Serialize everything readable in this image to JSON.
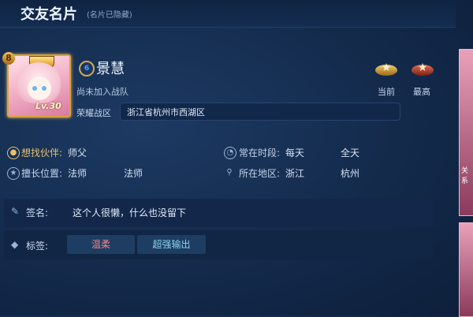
{
  "header": {
    "title": "交友名片",
    "subtitle": "(名片已隐藏)"
  },
  "profile": {
    "level": "Lv.30",
    "vip_level": "8",
    "rank_icon_text": "6",
    "name": "景慧",
    "team_status": "尚未加入战队",
    "zone_label": "荣耀战区",
    "zone_value": "浙江省杭州市西湖区"
  },
  "medals": [
    {
      "label": "当前",
      "icon": "gold-wing-star-icon"
    },
    {
      "label": "最高",
      "icon": "red-wing-star-icon"
    }
  ],
  "info": {
    "partner_label": "想找伙伴:",
    "partner_value": "师父",
    "position_label": "擅长位置:",
    "position_value1": "法师",
    "position_value2": "法师",
    "time_label": "常在时段:",
    "time_value1": "每天",
    "time_value2": "全天",
    "location_label": "所在地区:",
    "location_value1": "浙江",
    "location_value2": "杭州"
  },
  "signature": {
    "label": "签名:",
    "text": "这个人很懒，什么也没留下"
  },
  "tags": {
    "label": "标签:",
    "items": [
      "温柔",
      "超强输出"
    ]
  },
  "side": {
    "card_text": "关系"
  },
  "colors": {
    "accent_gold": "#e6c170",
    "tag_red": "#f28888",
    "tag_blue": "#8fd2ef"
  }
}
